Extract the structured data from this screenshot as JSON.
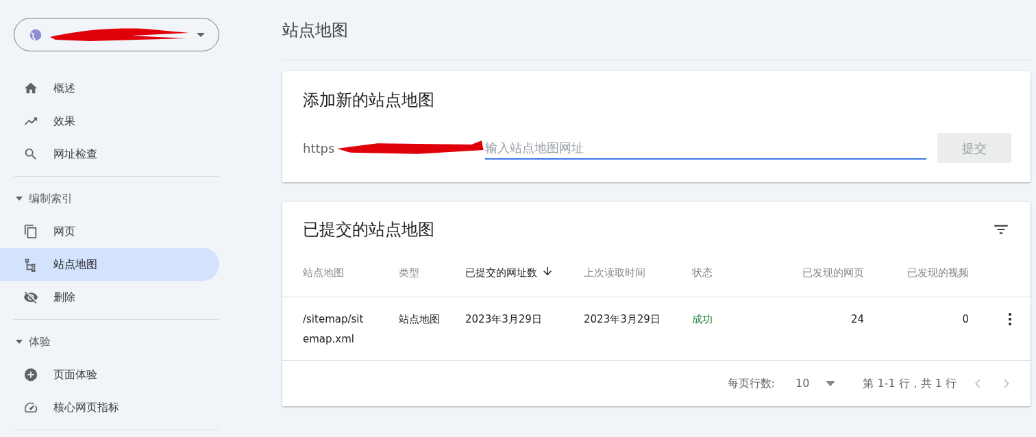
{
  "sidebar": [
    {
      "kind": "item",
      "label": "概述",
      "selected": false
    },
    {
      "kind": "item",
      "label": "效果",
      "selected": false
    },
    {
      "kind": "item",
      "label": "网址检查",
      "selected": false
    },
    {
      "kind": "section",
      "label": "编制索引",
      "expanded": true,
      "children": [
        {
          "kind": "item",
          "label": "网页",
          "selected": false
        },
        {
          "kind": "item",
          "label": "站点地图",
          "selected": true
        },
        {
          "kind": "item",
          "label": "删除",
          "selected": false
        }
      ]
    },
    {
      "kind": "section",
      "label": "体验",
      "expanded": true,
      "children": [
        {
          "kind": "item",
          "label": "页面体验",
          "selected": false
        },
        {
          "kind": "item",
          "label": "核心网页指标",
          "selected": false
        }
      ]
    }
  ],
  "page_title": "站点地图",
  "add_card": {
    "title": "添加新的站点地图",
    "url_prefix": "https",
    "placeholder": "输入站点地图网址",
    "submit": "提交",
    "submit_disabled": true
  },
  "submitted_card": {
    "title": "已提交的站点地图",
    "columns": [
      {
        "label": "站点地图",
        "sorted": false,
        "numeric": false
      },
      {
        "label": "类型",
        "sorted": false,
        "numeric": false
      },
      {
        "label": "已提交的网址数",
        "sorted": true,
        "numeric": false
      },
      {
        "label": "上次读取时间",
        "sorted": false,
        "numeric": false
      },
      {
        "label": "状态",
        "sorted": false,
        "numeric": false
      },
      {
        "label": "已发现的网页",
        "sorted": false,
        "numeric": true
      },
      {
        "label": "已发现的视频",
        "sorted": false,
        "numeric": true
      }
    ],
    "rows": [
      {
        "cells": [
          "/sitemap/sitemap.xml",
          "站点地图",
          "2023年3月29日",
          "2023年3月29日",
          "成功",
          "24",
          "0"
        ],
        "color": "#188038"
      }
    ],
    "pagination": {
      "rows_label": "每页行数:",
      "rows_per_page": "10",
      "range": "第 1-1 行，共 1 行",
      "prev_disabled": true,
      "next_disabled": true
    }
  }
}
